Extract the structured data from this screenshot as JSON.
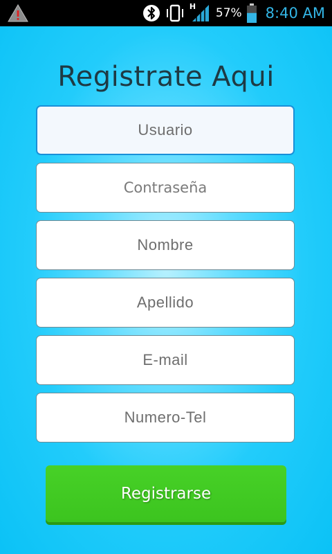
{
  "status_bar": {
    "warning_icon": "warning-icon",
    "bluetooth_icon": "bluetooth-icon",
    "vibrate_icon": "vibrate-icon",
    "network_type": "H",
    "signal_icon": "signal-icon",
    "battery_percent": "57%",
    "battery_level": 0.57,
    "battery_icon": "battery-icon",
    "time": "8:40 AM",
    "clock_color": "#33b5e5"
  },
  "title": "Registrate Aqui",
  "fields": [
    {
      "placeholder": "Usuario",
      "value": ""
    },
    {
      "placeholder": "Contraseña",
      "value": ""
    },
    {
      "placeholder": "Nombre",
      "value": ""
    },
    {
      "placeholder": "Apellido",
      "value": ""
    },
    {
      "placeholder": "E-mail",
      "value": ""
    },
    {
      "placeholder": "Numero-Tel",
      "value": ""
    }
  ],
  "register_button": {
    "label": "Registrarse"
  },
  "colors": {
    "background": "#22ccfb",
    "button": "#3fc922",
    "focus_border": "#1a8fd8"
  }
}
